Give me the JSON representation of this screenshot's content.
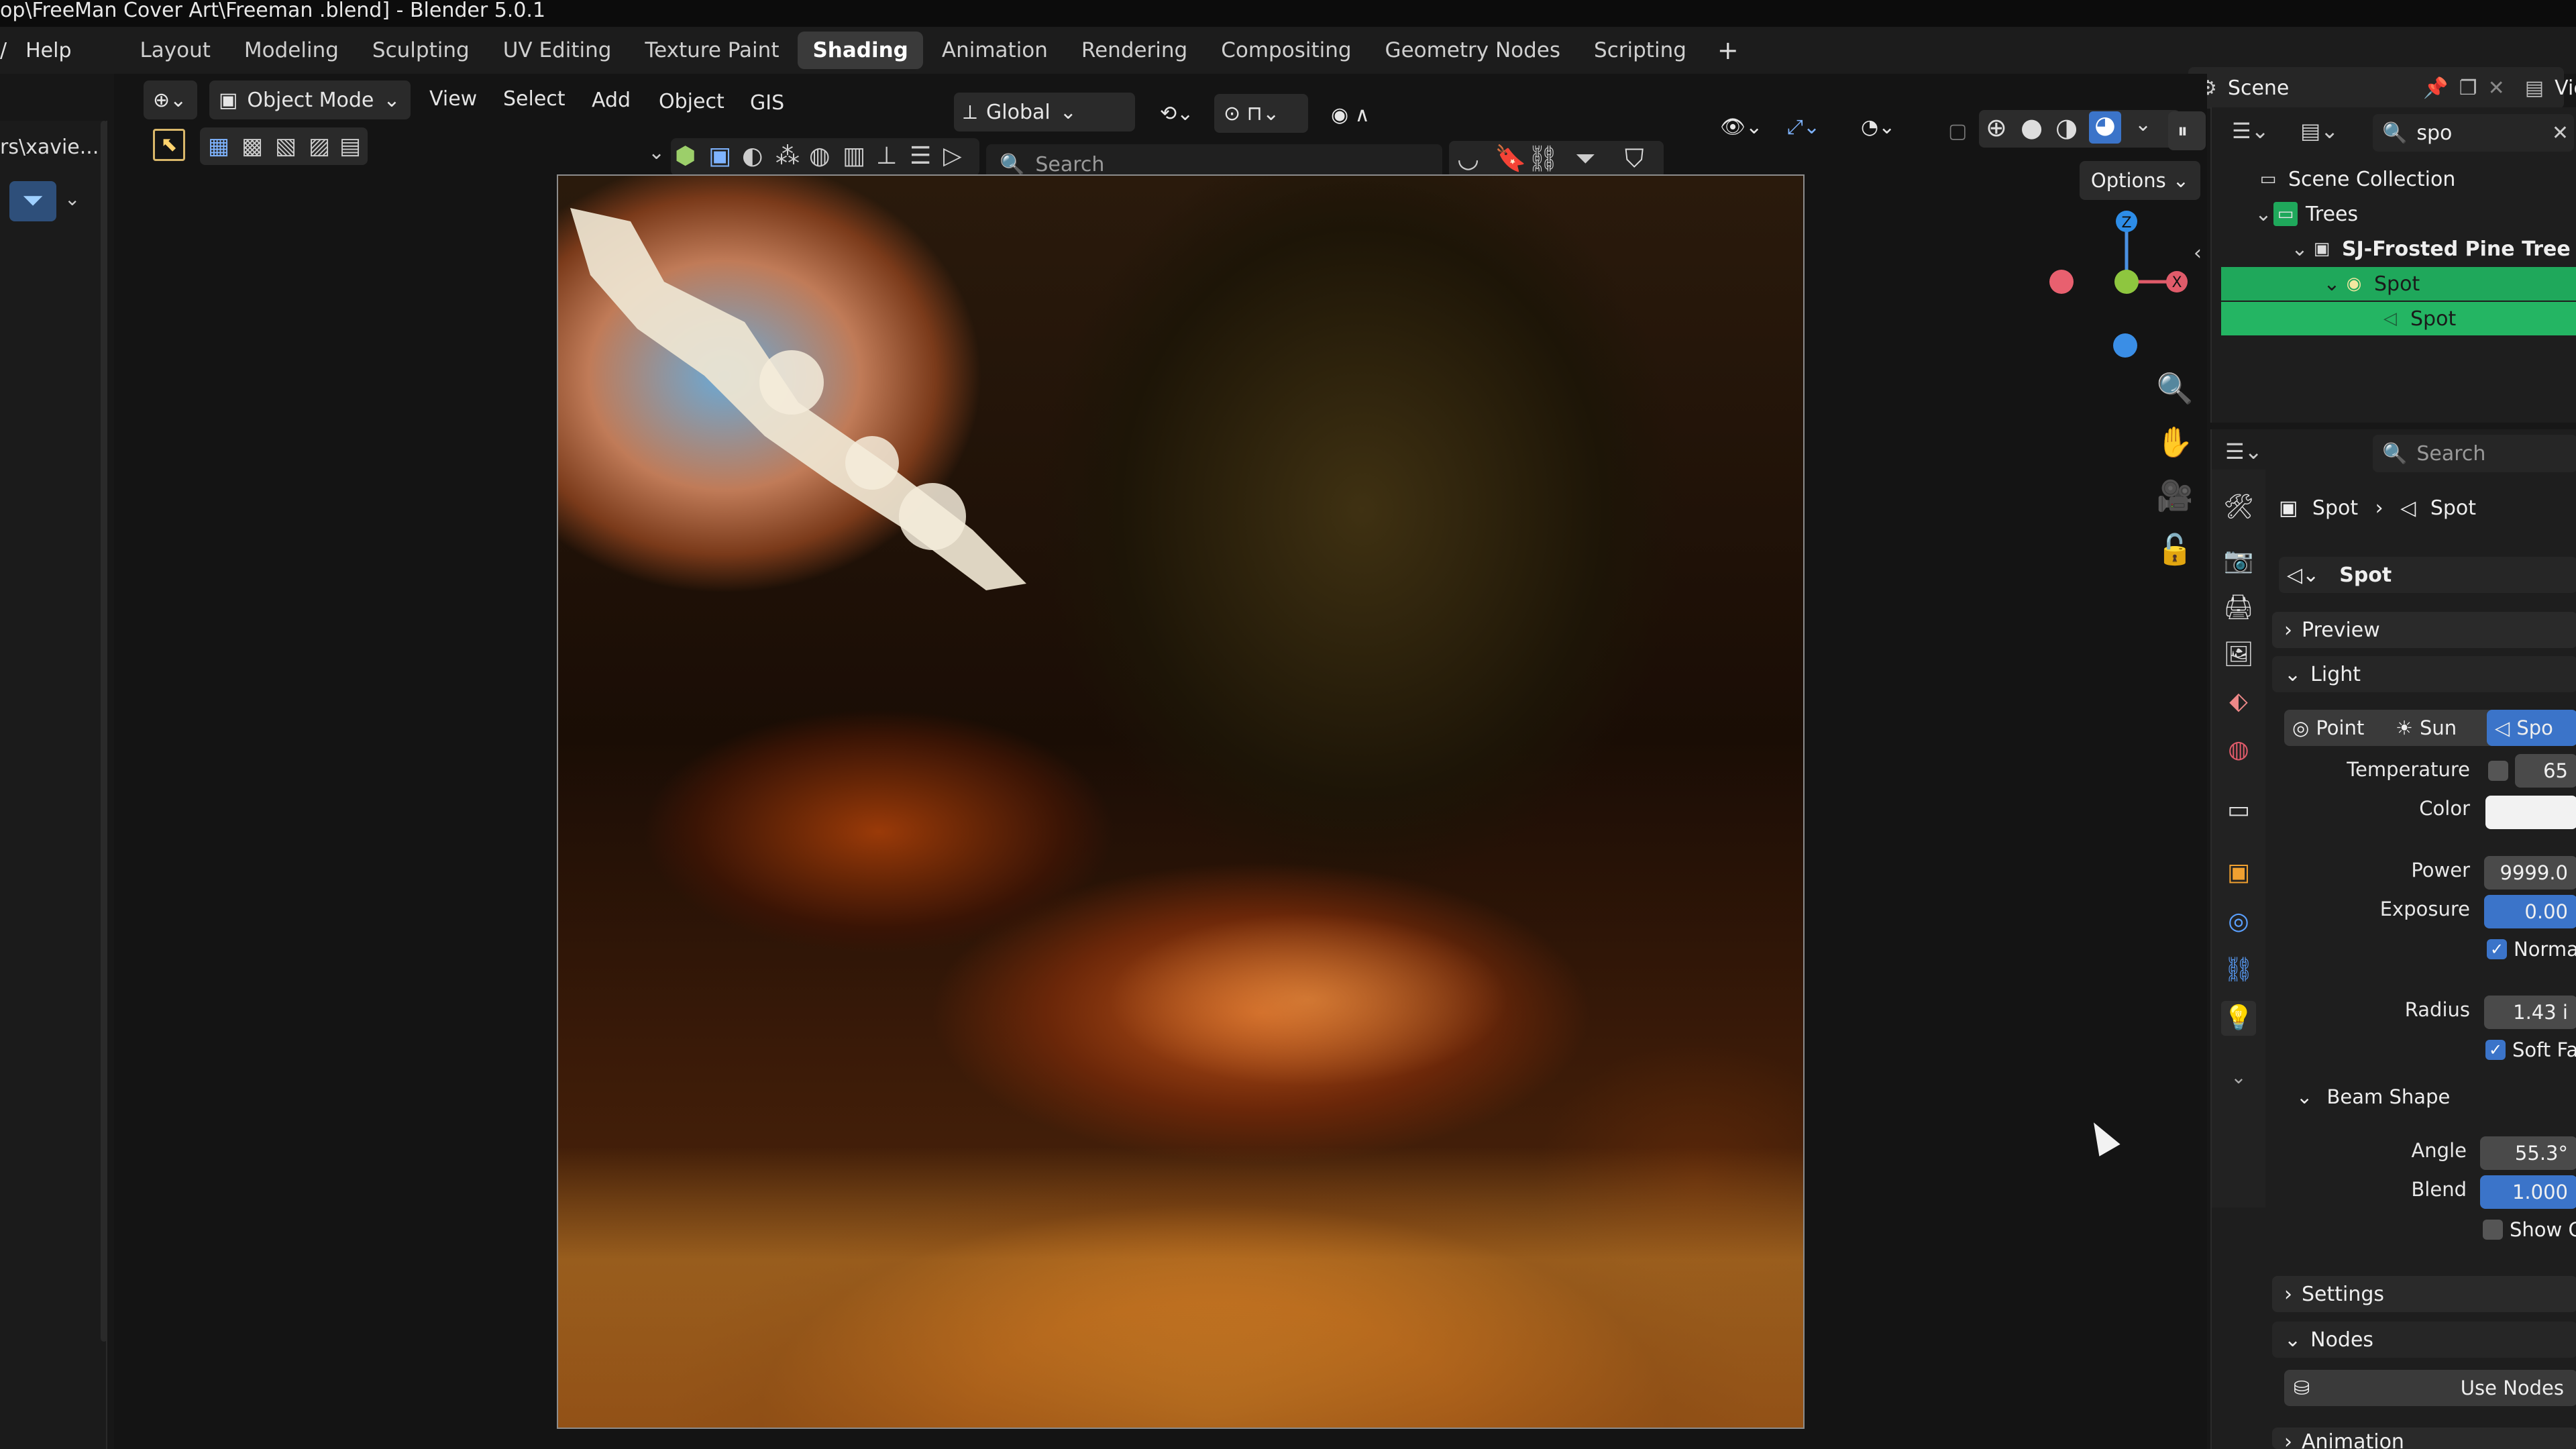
{
  "window": {
    "title": "op\\FreeMan Cover Art\\Freeman .blend] - Blender 5.0.1"
  },
  "menubar": {
    "help": "Help"
  },
  "workspaces": [
    "Layout",
    "Modeling",
    "Sculpting",
    "UV Editing",
    "Texture Paint",
    "Shading",
    "Animation",
    "Rendering",
    "Compositing",
    "Geometry Nodes",
    "Scripting"
  ],
  "active_workspace": "Shading",
  "scene": {
    "label": "Scene",
    "view_layer": "Vie"
  },
  "left_panel": {
    "path": "rs\\xavie..."
  },
  "viewport": {
    "mode": "Object Mode",
    "menus": [
      "View",
      "Select",
      "Add",
      "Object",
      "GIS"
    ],
    "orientation": "Global",
    "search_placeholder": "Search",
    "options": "Options"
  },
  "gizmo": {
    "z": "Z",
    "x": "X"
  },
  "outliner": {
    "search_value": "spo",
    "items": [
      "Scene Collection",
      "Trees",
      "SJ-Frosted Pine Tree",
      "Spot",
      "Spot"
    ]
  },
  "properties": {
    "search_placeholder": "Search",
    "breadcrumb": [
      "Spot",
      "Spot"
    ],
    "datablock": "Spot",
    "panels": {
      "preview": "Preview",
      "light": "Light",
      "settings": "Settings",
      "nodes": "Nodes",
      "animation": "Animation"
    },
    "light_types": [
      "Point",
      "Sun",
      "Spo"
    ],
    "fields": {
      "temperature_label": "Temperature",
      "temperature_value": "65",
      "color_label": "Color",
      "power_label": "Power",
      "power_value": "9999.0",
      "exposure_label": "Exposure",
      "exposure_value": "0.00",
      "normalize_label": "Normalize",
      "radius_label": "Radius",
      "radius_value": "1.43 i",
      "soft_falloff_label": "Soft Falloff",
      "beam_shape_label": "Beam Shape",
      "angle_label": "Angle",
      "angle_value": "55.3°",
      "blend_label": "Blend",
      "blend_value": "1.000",
      "show_cone_label": "Show Cone",
      "use_nodes_label": "Use Nodes"
    }
  },
  "colors": {
    "accent_blue": "#3b74c9",
    "selection_green": "#1fa85b",
    "panel_bg": "#1e1e1e"
  }
}
